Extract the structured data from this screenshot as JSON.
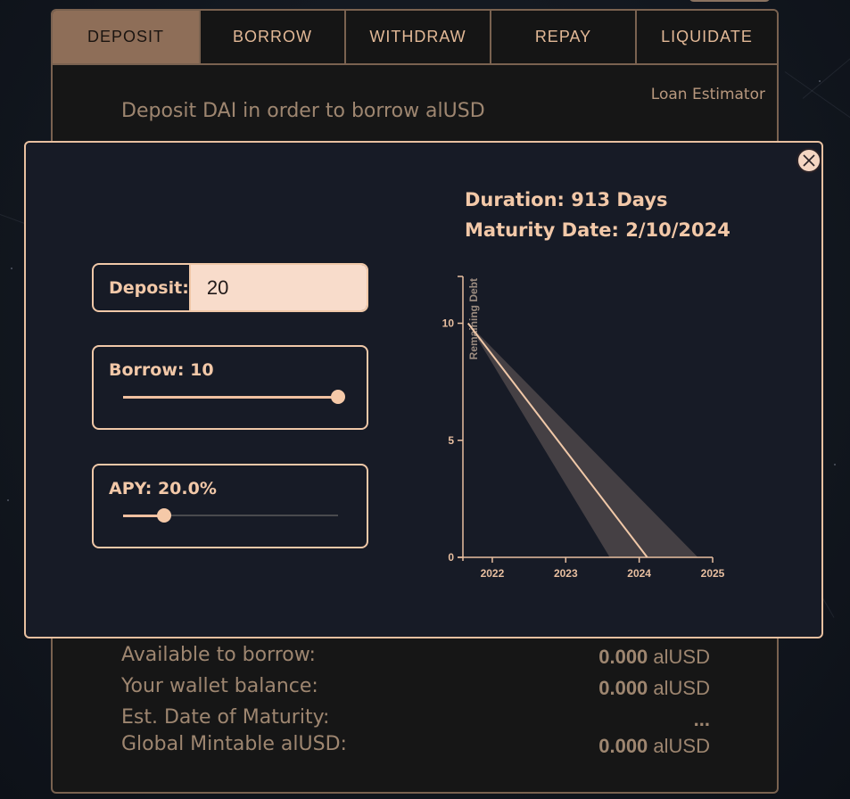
{
  "tabs": [
    {
      "label": "DEPOSIT",
      "active": true
    },
    {
      "label": "BORROW",
      "active": false
    },
    {
      "label": "WITHDRAW",
      "active": false
    },
    {
      "label": "REPAY",
      "active": false
    },
    {
      "label": "LIQUIDATE",
      "active": false
    }
  ],
  "card": {
    "loan_estimator_link": "Loan Estimator",
    "heading": "Deposit DAI in order to borrow alUSD"
  },
  "stats": [
    {
      "label": "Available to borrow:",
      "amount": "0.000",
      "unit": "alUSD"
    },
    {
      "label": "Your wallet balance:",
      "amount": "0.000",
      "unit": "alUSD"
    },
    {
      "label": "Est. Date of Maturity:",
      "amount": "...",
      "unit": ""
    },
    {
      "label": "Global Mintable alUSD:",
      "amount": "0.000",
      "unit": "alUSD"
    }
  ],
  "modal": {
    "close_icon": "close-x-icon",
    "duration_text": "Duration: 913 Days",
    "maturity_text": "Maturity Date: 2/10/2024",
    "deposit": {
      "label": "Deposit:",
      "value": "20"
    },
    "borrow": {
      "label": "Borrow: 10",
      "value": 10,
      "fraction": 1.0
    },
    "apy": {
      "label": "APY: 20.0%",
      "value": 20.0,
      "fraction": 0.19
    }
  },
  "colors": {
    "accent": "#f2c8a8",
    "active_tab": "#8e6e58",
    "modal_bg": "#171b26",
    "band": "#4a4548"
  },
  "chart_data": {
    "type": "line",
    "title": "",
    "xlabel": "",
    "ylabel": "Remaining Debt",
    "x_ticks": [
      "2022",
      "2023",
      "2024",
      "2025"
    ],
    "y_ticks": [
      0,
      5,
      10
    ],
    "xlim": [
      2021.6,
      2025.0
    ],
    "ylim": [
      0,
      12
    ],
    "series": [
      {
        "x": [
          2021.67,
          2024.11
        ],
        "y": [
          10,
          0
        ]
      }
    ],
    "band": {
      "x_start": 2021.67,
      "y_start": 10,
      "x_end_low": 2023.6,
      "x_end_high": 2024.8
    }
  }
}
